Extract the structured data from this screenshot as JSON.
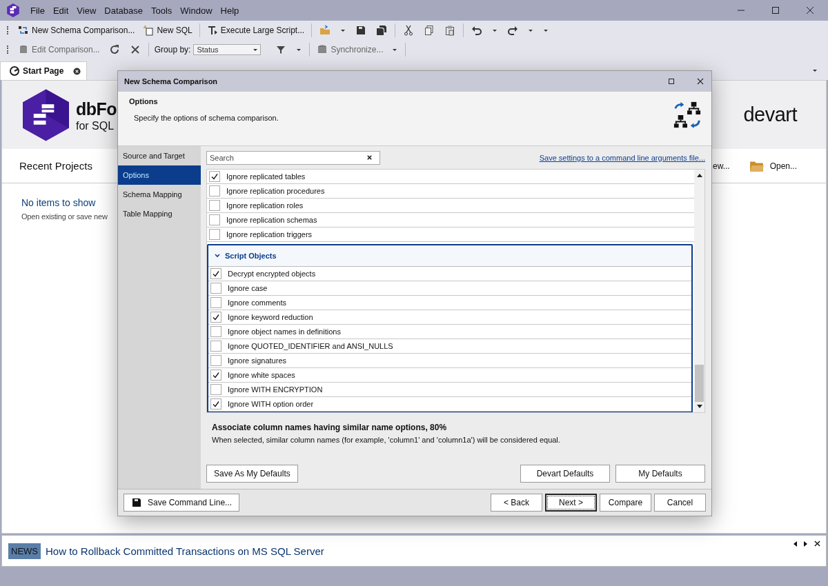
{
  "menu": [
    "File",
    "Edit",
    "View",
    "Database",
    "Tools",
    "Window",
    "Help"
  ],
  "toolbar_main": {
    "new_schema_comparison": "New Schema Comparison...",
    "new_sql": "New SQL",
    "execute_large_script": "Execute Large Script..."
  },
  "toolbar_comparison": {
    "edit_comparison": {
      "label": "Edit Comparison...",
      "disabled": true
    },
    "group_by_label": "Group by:",
    "group_by_value": "Status",
    "synchronize": {
      "label": "Synchronize...",
      "disabled": true
    }
  },
  "tabs": [
    {
      "label": "Start Page",
      "selected": true
    }
  ],
  "start_page": {
    "product_name": "dbFo",
    "product_edition": "for SQL",
    "vendor_logo": "devart",
    "recent_projects": "Recent Projects",
    "actions": [
      "ew...",
      "Open..."
    ],
    "empty_title": "No items to show",
    "empty_hint": "Open existing or save new"
  },
  "news": {
    "badge": "NEWS",
    "headline": "How to Rollback Committed Transactions on MS SQL Server"
  },
  "dialog": {
    "title": "New Schema Comparison",
    "header": {
      "title": "Options",
      "subtitle": "Specify the options of schema comparison."
    },
    "steps": [
      {
        "label": "Source and Target",
        "selected": false
      },
      {
        "label": "Options",
        "selected": true
      },
      {
        "label": "Schema Mapping",
        "selected": false
      },
      {
        "label": "Table Mapping",
        "selected": false
      }
    ],
    "search": {
      "placeholder": "Search"
    },
    "save_settings_link": "Save settings to a command line arguments file...",
    "option_groups": [
      {
        "items": [
          {
            "label": "Ignore replicated tables",
            "checked": true
          },
          {
            "label": "Ignore replication procedures",
            "checked": false
          },
          {
            "label": "Ignore replication roles",
            "checked": false
          },
          {
            "label": "Ignore replication schemas",
            "checked": false
          },
          {
            "label": "Ignore replication triggers",
            "checked": false
          }
        ]
      },
      {
        "title": "Script Objects",
        "expanded": true,
        "items": [
          {
            "label": "Decrypt encrypted objects",
            "checked": true
          },
          {
            "label": "Ignore case",
            "checked": false
          },
          {
            "label": "Ignore comments",
            "checked": false
          },
          {
            "label": "Ignore keyword reduction",
            "checked": true
          },
          {
            "label": "Ignore object names in definitions",
            "checked": false
          },
          {
            "label": "Ignore QUOTED_IDENTIFIER and ANSI_NULLS",
            "checked": false
          },
          {
            "label": "Ignore signatures",
            "checked": false
          },
          {
            "label": "Ignore white spaces",
            "checked": true
          },
          {
            "label": "Ignore WITH ENCRYPTION",
            "checked": false
          },
          {
            "label": "Ignore WITH option order",
            "checked": true
          }
        ]
      }
    ],
    "description": {
      "title": "Associate column names having similar name options, 80%",
      "text": "When selected, similar column names (for example, 'column1' and 'column1a') will be considered equal."
    },
    "defaults_buttons": [
      "Save As My Defaults",
      "Devart Defaults",
      "My Defaults"
    ],
    "save_command_line": "Save Command Line...",
    "nav_buttons": [
      {
        "label": "< Back",
        "default": false
      },
      {
        "label": "Next >",
        "default": true
      },
      {
        "label": "Compare",
        "default": false
      },
      {
        "label": "Cancel",
        "default": false
      }
    ]
  }
}
